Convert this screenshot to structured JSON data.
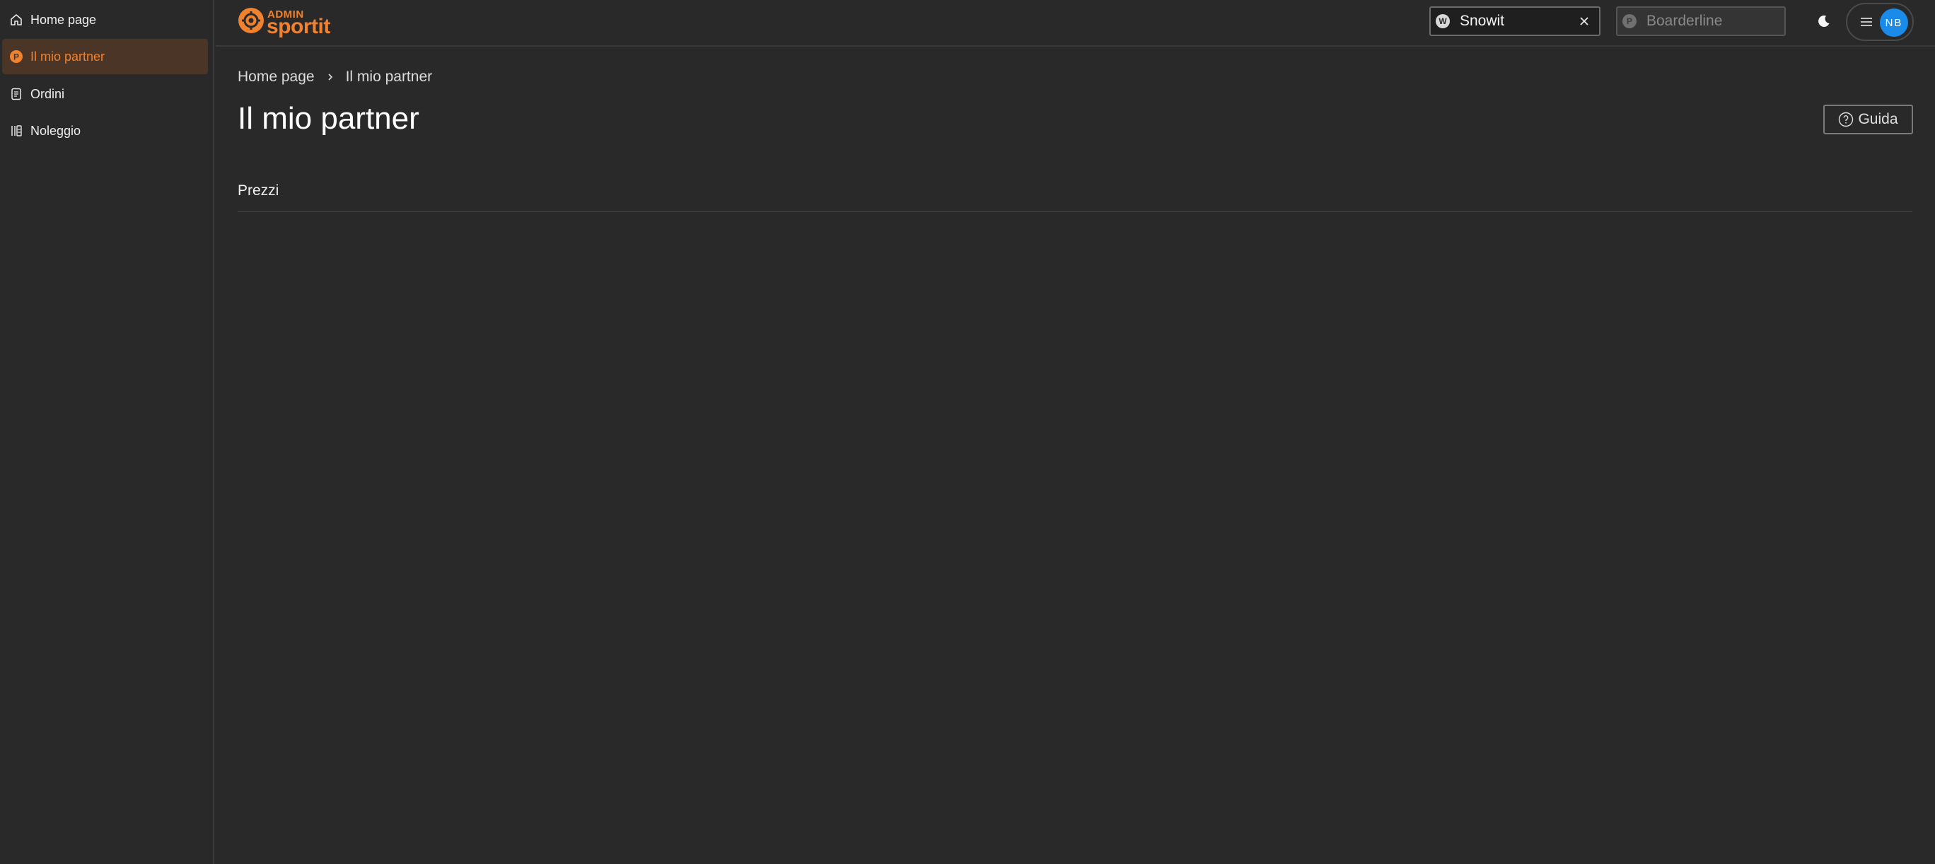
{
  "sidebar": {
    "items": [
      {
        "label": "Home page",
        "icon": "home-icon"
      },
      {
        "label": "Il mio partner",
        "icon": "partner-p-icon",
        "active": true
      },
      {
        "label": "Ordini",
        "icon": "document-icon"
      },
      {
        "label": "Noleggio",
        "icon": "rental-icon"
      }
    ]
  },
  "header": {
    "logo": {
      "top": "ADMIN",
      "bottom": "sportit"
    },
    "brand_color": "#f0822f",
    "website_select": {
      "badge": "W",
      "value": "Snowit"
    },
    "partner_select": {
      "badge": "P",
      "placeholder": "Boarderline"
    },
    "avatar_initials": "NB",
    "avatar_color": "#1a8be8"
  },
  "main": {
    "breadcrumb": [
      "Home page",
      "Il mio partner"
    ],
    "title": "Il mio partner",
    "guide_label": "Guida",
    "tabs": [
      {
        "label": "Prezzi"
      }
    ]
  }
}
